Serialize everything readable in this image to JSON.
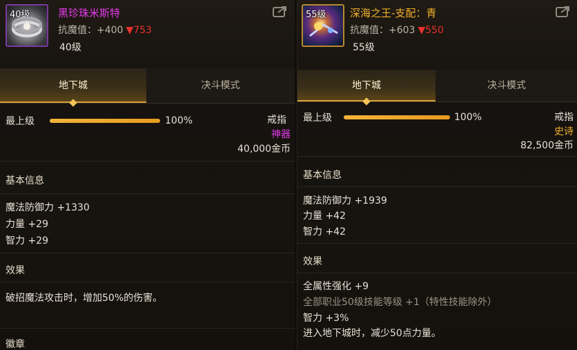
{
  "left": {
    "level_badge": "40级",
    "item_name": "黑珍珠米斯特",
    "resist_label": "抗魔值：+400",
    "resist_delta": "▼753",
    "required_level": "40级",
    "tabs": [
      "地下城",
      "决斗模式"
    ],
    "grade_label": "最上级",
    "grade_percent": "100%",
    "grade_value": 1.0,
    "item_type": "戒指",
    "rarity": "神器",
    "rarity_color": "#e23ae8",
    "price": "40,000金币",
    "basic_info_title": "基本信息",
    "stats": [
      "魔法防御力 +1330",
      "力量 +29",
      "智力 +29"
    ],
    "effect_title": "效果",
    "effects": [
      "破招魔法攻击时，增加50%的伤害。"
    ],
    "emblem_title": "徽章"
  },
  "right": {
    "level_badge": "55级",
    "item_name": "深海之王-支配：青",
    "resist_label": "抗魔值：+603",
    "resist_delta": "▼550",
    "required_level": "55级",
    "tabs": [
      "地下城",
      "决斗模式"
    ],
    "grade_label": "最上级",
    "grade_percent": "100%",
    "grade_value": 1.0,
    "item_type": "戒指",
    "rarity": "史诗",
    "rarity_color": "#f0b02a",
    "price": "82,500金币",
    "basic_info_title": "基本信息",
    "stats": [
      "魔法防御力 +1939",
      "力量 +42",
      "智力 +42"
    ],
    "effect_title": "效果",
    "effects": [
      "全属性强化 +9",
      "全部职业50级技能等级 +1（特性技能除外）",
      "智力 +3%",
      "进入地下城时，减少50点力量。"
    ]
  }
}
